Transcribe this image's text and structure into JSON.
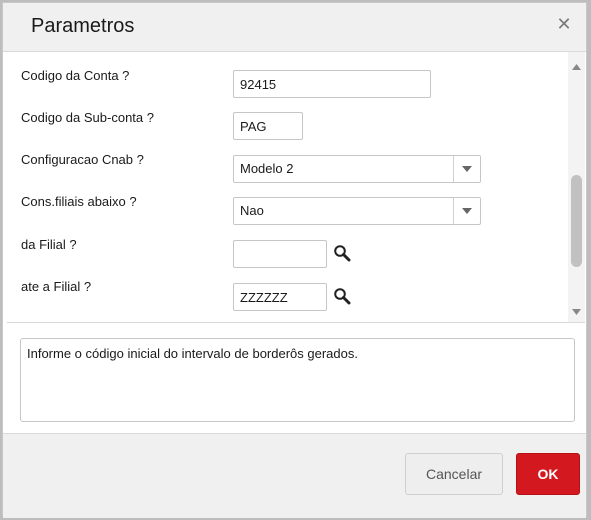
{
  "dialog": {
    "title": "Parametros",
    "close_glyph": "✕"
  },
  "form": {
    "fields": [
      {
        "label": "Codigo da Conta ?",
        "type": "text",
        "value": "92415"
      },
      {
        "label": "Codigo da Sub-conta ?",
        "type": "text",
        "value": "PAG"
      },
      {
        "label": "Configuracao Cnab ?",
        "type": "select",
        "value": "Modelo 2"
      },
      {
        "label": "Cons.filiais abaixo ?",
        "type": "select",
        "value": "Nao"
      },
      {
        "label": "da Filial ?",
        "type": "lookup",
        "value": ""
      },
      {
        "label": "ate a Filial ?",
        "type": "lookup",
        "value": "ZZZZZZ"
      }
    ]
  },
  "help": {
    "text": "Informe o código inicial do intervalo de borderôs gerados."
  },
  "footer": {
    "cancel_label": "Cancelar",
    "ok_label": "OK"
  },
  "colors": {
    "ok_button": "#d4181f",
    "title_bar": "#f0f0f0"
  },
  "icons": {
    "close": "close-icon",
    "dropdown": "chevron-down-icon",
    "lookup": "search-icon",
    "scroll_up": "arrow-up-icon",
    "scroll_down": "arrow-down-icon"
  }
}
